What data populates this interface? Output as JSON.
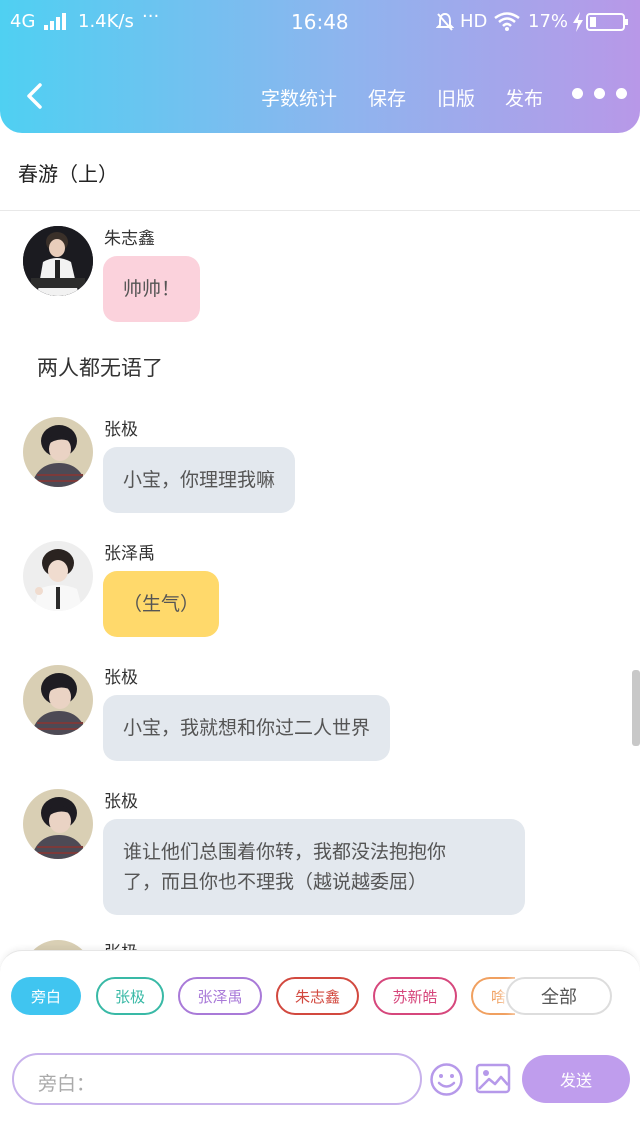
{
  "status_bar": {
    "network": "4G",
    "speed": "1.4K/s",
    "dots": "···",
    "time": "16:48",
    "hd": "HD",
    "battery": "17%"
  },
  "toolbar": {
    "word_count": "字数统计",
    "save": "保存",
    "old_version": "旧版",
    "publish": "发布"
  },
  "story_title": "春游（上）",
  "messages": [
    {
      "name": "朱志鑫",
      "text": "帅帅！"
    },
    {
      "narration": "两人都无语了"
    },
    {
      "name": "张极",
      "text": "小宝，你理理我嘛"
    },
    {
      "name": "张泽禹",
      "text": "（生气）"
    },
    {
      "name": "张极",
      "text": "小宝，我就想和你过二人世界"
    },
    {
      "name": "张极",
      "line1": "谁让他们总围着你转，我都没法抱抱你",
      "line2": "了，而且你也不理我（越说越委屈）"
    },
    {
      "name": "张极"
    }
  ],
  "chips": [
    {
      "label": "旁白",
      "color": "#40c5f0"
    },
    {
      "label": "张极",
      "color": "#39b9a6"
    },
    {
      "label": "张泽禹",
      "color": "#a97ad8"
    },
    {
      "label": "朱志鑫",
      "color": "#d2493f"
    },
    {
      "label": "苏新皓",
      "color": "#d6477c"
    },
    {
      "label": "啥",
      "color": "#f0a060"
    },
    {
      "label": "全部",
      "color": "#999999"
    }
  ],
  "input": {
    "placeholder": "旁白："
  },
  "send_label": "发送",
  "colors": {
    "bubble_pink": "#fbd2dc",
    "bubble_gray": "#e3e8ee",
    "bubble_yellow": "#ffd96b"
  }
}
